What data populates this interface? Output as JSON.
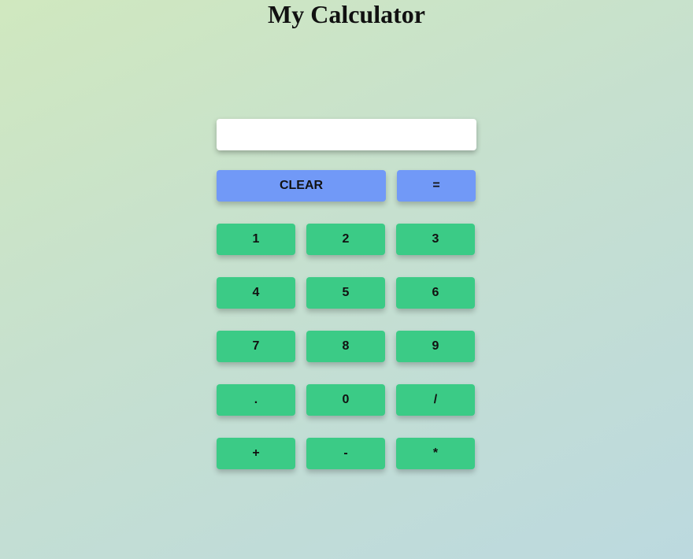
{
  "page": {
    "title": "My Calculator"
  },
  "display": {
    "value": "",
    "placeholder": ""
  },
  "controls": {
    "clear_label": "CLEAR",
    "equals_label": "="
  },
  "keys": {
    "k1": "1",
    "k2": "2",
    "k3": "3",
    "k4": "4",
    "k5": "5",
    "k6": "6",
    "k7": "7",
    "k8": "8",
    "k9": "9",
    "dot": ".",
    "k0": "0",
    "divide": "/",
    "plus": "+",
    "minus": "-",
    "multiply": "*"
  },
  "colors": {
    "operator_button": "#7199f7",
    "number_button": "#3bcb86",
    "display_background": "#ffffff"
  }
}
